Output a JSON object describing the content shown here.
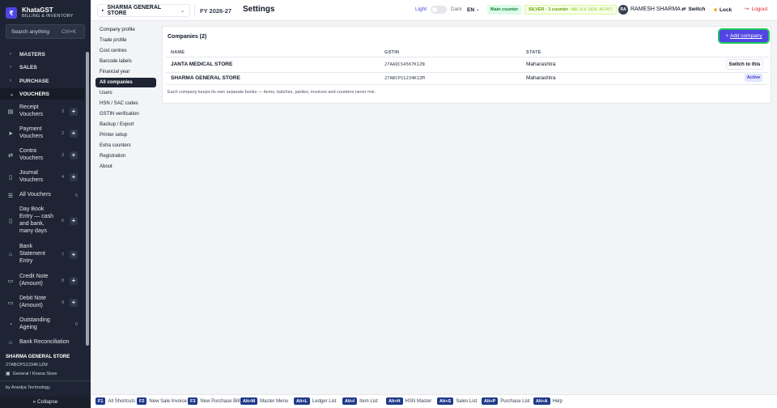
{
  "brand": {
    "name": "KhataGST",
    "subtitle": "BILLING & INVENTORY",
    "logo": "₹"
  },
  "sidebar": {
    "search_placeholder": "Search anything",
    "search_shortcut": "Ctrl+K",
    "sections": [
      {
        "label": "MASTERS"
      },
      {
        "label": "SALES"
      },
      {
        "label": "PURCHASE"
      },
      {
        "label": "VOUCHERS"
      }
    ],
    "vouchers": [
      {
        "label": "Receipt Vouchers",
        "count": "3",
        "icon": "receipt-icon"
      },
      {
        "label": "Payment Vouchers",
        "count": "2",
        "icon": "send-icon"
      },
      {
        "label": "Contra Vouchers",
        "count": "3",
        "icon": "swap-icon"
      },
      {
        "label": "Journal Vouchers",
        "count": "4",
        "icon": "book-icon"
      },
      {
        "label": "All Vouchers",
        "count": "5",
        "icon": "list-icon"
      },
      {
        "label": "Day Book Entry — cash and bank, many days",
        "count": "6",
        "icon": "book-icon"
      },
      {
        "label": "Bank Statement Entry",
        "count": "7",
        "icon": "bank-icon"
      },
      {
        "label": "Credit Note (Amount)",
        "count": "8",
        "icon": "note-icon"
      },
      {
        "label": "Debit Note (Amount)",
        "count": "9",
        "icon": "note-icon"
      },
      {
        "label": "Outstanding Ageing",
        "count": "0",
        "icon": "clock-icon"
      },
      {
        "label": "Bank Reconciliation",
        "count": "",
        "icon": "bank-icon"
      }
    ],
    "footer": {
      "company": "SHARMA GENERAL STORE",
      "gstin": "27ABCPS1234K1ZM",
      "type": "General / Kirana Store",
      "by": "by Anedya Technology",
      "collapse": "« Collapse"
    }
  },
  "topbar": {
    "company": "SHARMA GENERAL STORE",
    "fy": "FY 2026-27",
    "title": "Settings",
    "theme_light": "Light",
    "theme_dark": "Dark",
    "lang": "EN",
    "counter": "Main counter",
    "license_plan": "SILVER · 1 counter",
    "license_key": "AND-SLV-2026-AEFPXT",
    "user_initials": "RA",
    "user_name": "RAMESH SHARMA",
    "switch": "Switch",
    "lock": "Lock",
    "logout": "Logout"
  },
  "settings_menu": [
    "Company profile",
    "Trade profile",
    "Cost centres",
    "Barcode labels",
    "Financial year",
    "All companies",
    "Users",
    "HSN / SAC codes",
    "GSTIN verification",
    "Backup / Export",
    "Printer setup",
    "Extra counters",
    "Registration",
    "About"
  ],
  "companies": {
    "title": "Companies (2)",
    "add_prefix": "+ ",
    "add_label": "Add company",
    "columns": [
      "NAME",
      "GSTIN",
      "STATE"
    ],
    "rows": [
      {
        "name": "JANTA MEDICAL STORE",
        "gstin": "27AAQCS4567K1ZN",
        "state": "Maharashtra",
        "action": "Switch to this"
      },
      {
        "name": "SHARMA GENERAL STORE",
        "gstin": "27ABCPS1234K1ZM",
        "state": "Maharashtra",
        "action": "Active"
      }
    ],
    "note": "Each company keeps its own separate books — items, batches, parties, invoices and counters never mix."
  },
  "shortcuts": [
    {
      "key": "F1",
      "label": "All Shortcuts"
    },
    {
      "key": "F2",
      "label": "New Sale Invoice"
    },
    {
      "key": "F3",
      "label": "New Purchase Bill"
    },
    {
      "key": "Alt+M",
      "label": "Master Menu"
    },
    {
      "key": "Alt+L",
      "label": "Ledger List"
    },
    {
      "key": "Alt+I",
      "label": "Item List"
    },
    {
      "key": "Alt+H",
      "label": "HSN Master"
    },
    {
      "key": "Alt+S",
      "label": "Sales List"
    },
    {
      "key": "Alt+P",
      "label": "Purchase List"
    },
    {
      "key": "Alt+A",
      "label": "Help"
    }
  ]
}
